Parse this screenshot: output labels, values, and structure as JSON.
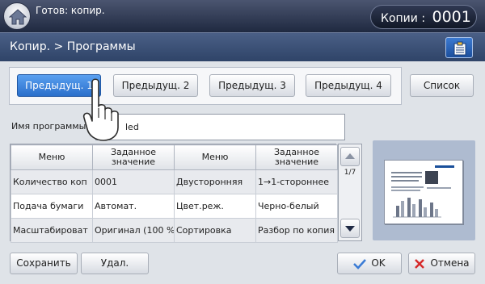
{
  "status": {
    "text": "Готов: копир."
  },
  "copies": {
    "label": "Копии",
    "value": "0001"
  },
  "header": {
    "title": "Копир. > Программы"
  },
  "presets": [
    {
      "label": "Предыдущ. 1",
      "selected": true
    },
    {
      "label": "Предыдущ. 2",
      "selected": false
    },
    {
      "label": "Предыдущ. 3",
      "selected": false
    },
    {
      "label": "Предыдущ. 4",
      "selected": false
    }
  ],
  "list_button": "Список",
  "program_name": {
    "label": "Имя программы",
    "value": "led"
  },
  "table": {
    "headers": [
      "Меню",
      "Заданное значение",
      "Меню",
      "Заданное значение"
    ],
    "rows": [
      [
        "Количество коп",
        "0001",
        "Двусторонняя",
        "1→1-стороннее"
      ],
      [
        "Подача бумаги",
        "Автомат.",
        "Цвет.реж.",
        "Черно-белый"
      ],
      [
        "Масштабироват",
        "Оригинал (100 %",
        "Сортировка",
        "Разбор по копия"
      ]
    ]
  },
  "page_indicator": "1/7",
  "buttons": {
    "save": "Сохранить",
    "delete": "Удал.",
    "ok": "OK",
    "cancel": "Отмена"
  },
  "colors": {
    "accent": "#2a6fcb",
    "ok_check": "#3a7bd5",
    "cancel_x": "#d62a2a"
  }
}
